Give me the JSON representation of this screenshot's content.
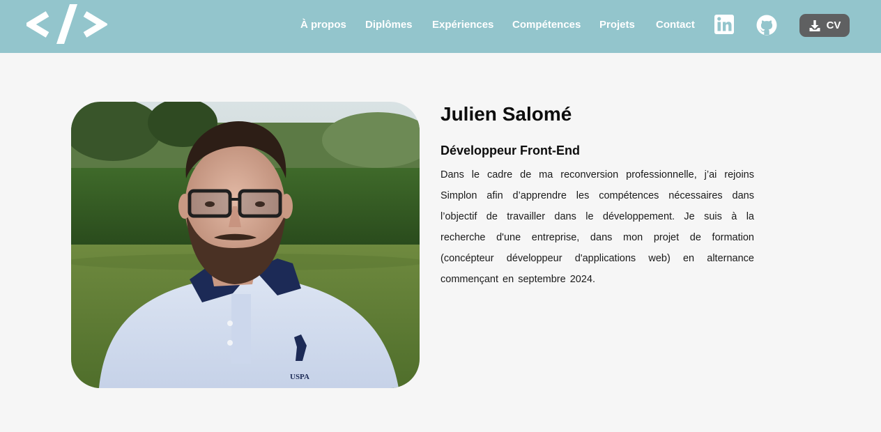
{
  "header": {
    "logo_icon": "code-brackets-icon",
    "nav": [
      {
        "label": "À propos"
      },
      {
        "label": "Diplômes"
      },
      {
        "label": "Expériences"
      },
      {
        "label": "Compétences"
      },
      {
        "label": "Projets"
      },
      {
        "label": "Contact"
      }
    ],
    "social": [
      {
        "icon": "linkedin-icon"
      },
      {
        "icon": "github-icon"
      }
    ],
    "cv_button": {
      "label": "CV",
      "icon": "download-icon"
    }
  },
  "hero": {
    "name": "Julien Salomé",
    "role": "Développeur Front-End",
    "bio": "Dans le cadre de ma reconversion professionnelle, j’ai rejoins Simplon afin d’apprendre les compétences nécessaires dans l’objectif de travailler dans le développement. Je suis à la recherche d'une entreprise, dans mon projet de formation (concépteur développeur d'applications web) en alternance commençant en septembre 2024."
  },
  "colors": {
    "header_bg": "#93c5cc",
    "page_bg": "#f6f6f6",
    "cv_button_bg": "#5f6061",
    "nav_text": "#ffffff"
  }
}
